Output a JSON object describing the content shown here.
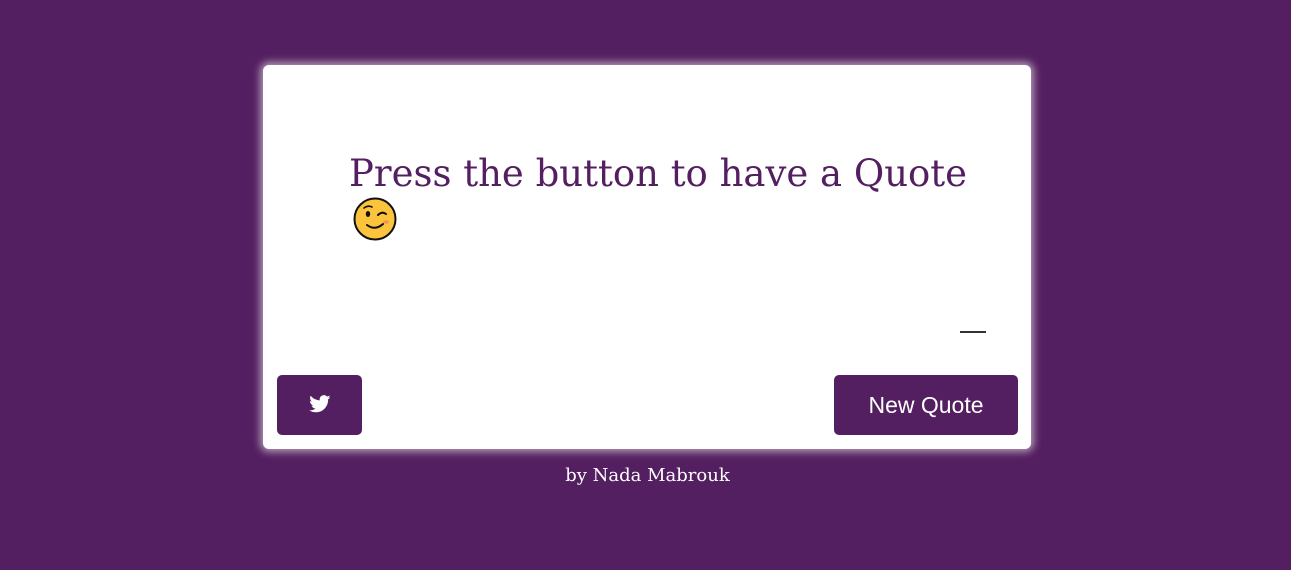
{
  "quote": {
    "text": "Press the button to have a Quote",
    "emoji_icon": "winking-face-icon",
    "author": ""
  },
  "buttons": {
    "twitter_icon": "twitter-bird-icon",
    "new_quote_label": "New Quote"
  },
  "footer": {
    "credit": "by Nada Mabrouk"
  },
  "colors": {
    "background": "#541f60",
    "card": "#ffffff",
    "accent": "#541f60",
    "emoji_fill": "#fcc33c"
  }
}
